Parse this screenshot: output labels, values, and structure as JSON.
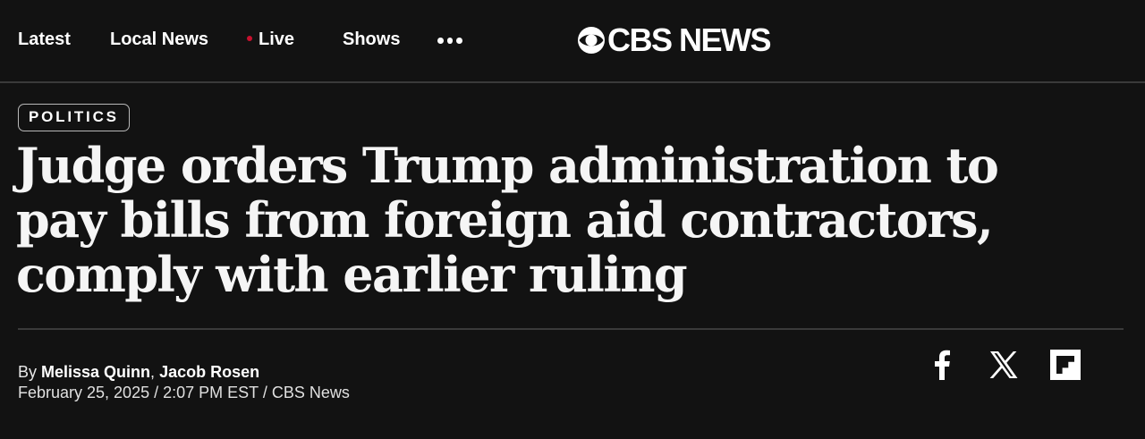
{
  "nav": {
    "items": [
      {
        "label": "Latest"
      },
      {
        "label": "Local News"
      },
      {
        "label": "Live",
        "indicator_color": "#c8102e"
      },
      {
        "label": "Shows"
      }
    ],
    "more_icon": "more-dots-icon"
  },
  "brand": {
    "logo_text": "CBS NEWS",
    "logo_icon": "cbs-eye-icon"
  },
  "article": {
    "category": "POLITICS",
    "headline": "Judge orders Trump administration to pay bills from foreign aid contractors, comply with earlier ruling",
    "byline_prefix": "By ",
    "authors": [
      "Melissa Quinn",
      "Jacob Rosen"
    ],
    "author_separator": ", ",
    "dateline": "February 25, 2025 / 2:07 PM EST / CBS News"
  },
  "share": {
    "icons": [
      "facebook-icon",
      "x-icon",
      "flipboard-icon"
    ]
  },
  "colors": {
    "background": "#121212",
    "text": "#ffffff",
    "live_dot": "#c8102e",
    "divider": "#3a3a3a"
  }
}
